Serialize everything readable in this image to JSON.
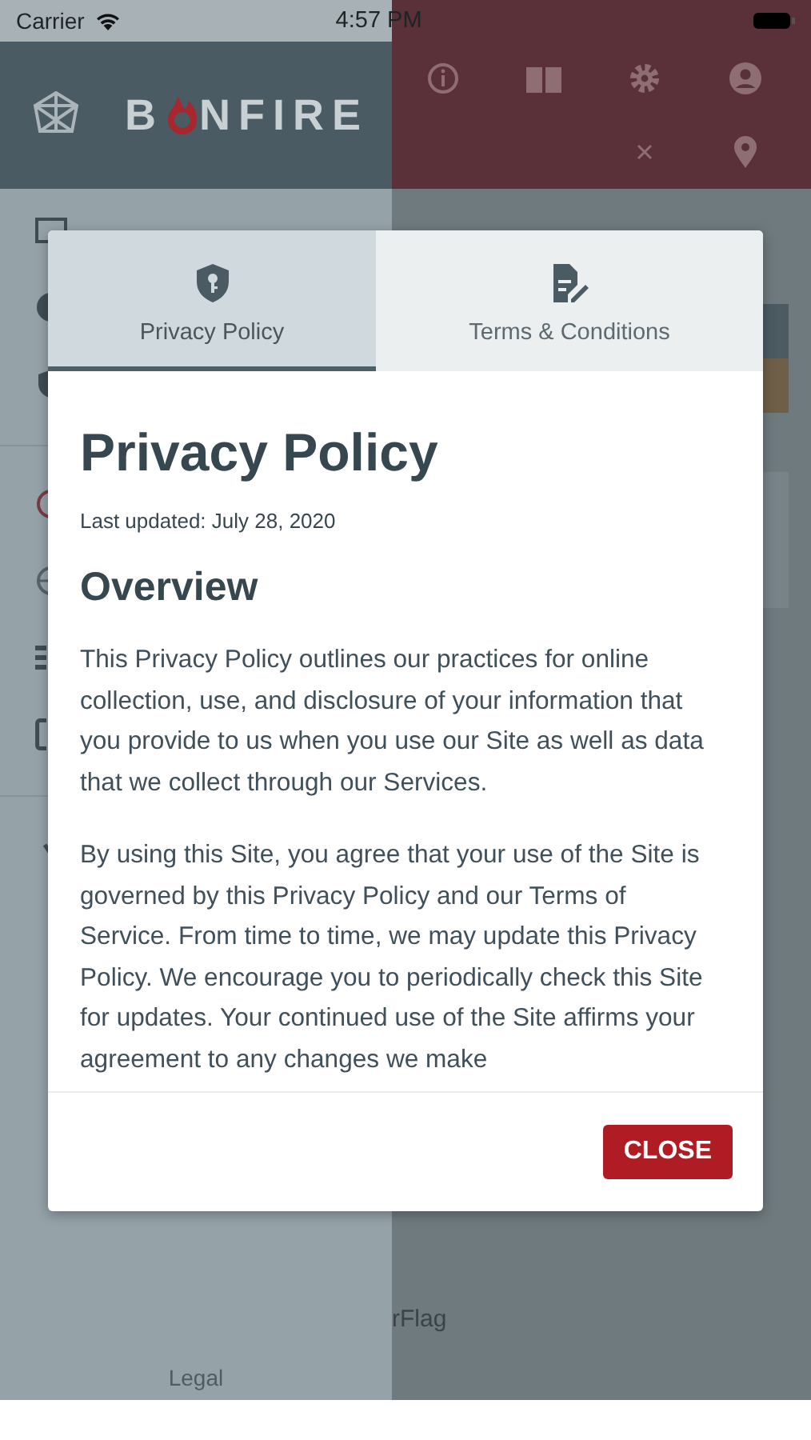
{
  "status_bar": {
    "carrier": "Carrier",
    "time": "4:57 PM"
  },
  "sidebar": {
    "logo": {
      "left": "B",
      "right": "NFIRE"
    },
    "footer_link": "Legal"
  },
  "main": {
    "partial_text": "rFlag"
  },
  "dialog": {
    "tabs": [
      {
        "label": "Privacy Policy",
        "selected": true
      },
      {
        "label": "Terms & Conditions",
        "selected": false
      }
    ],
    "title": "Privacy Policy",
    "updated": "Last updated: July 28, 2020",
    "heading": "Overview",
    "paragraphs": [
      "This Privacy Policy outlines our practices for online collection, use, and disclosure of your information that you provide to us when you use our Site as well as data that we collect through our Services.",
      "By using this Site, you agree that your use of the Site is governed by this Privacy Policy and our Terms of Service. From time to time, we may update this Privacy Policy. We encourage you to periodically check this Site for updates. Your continued use of the Site affirms your agreement to any changes we make"
    ],
    "close_button": "CLOSE"
  }
}
